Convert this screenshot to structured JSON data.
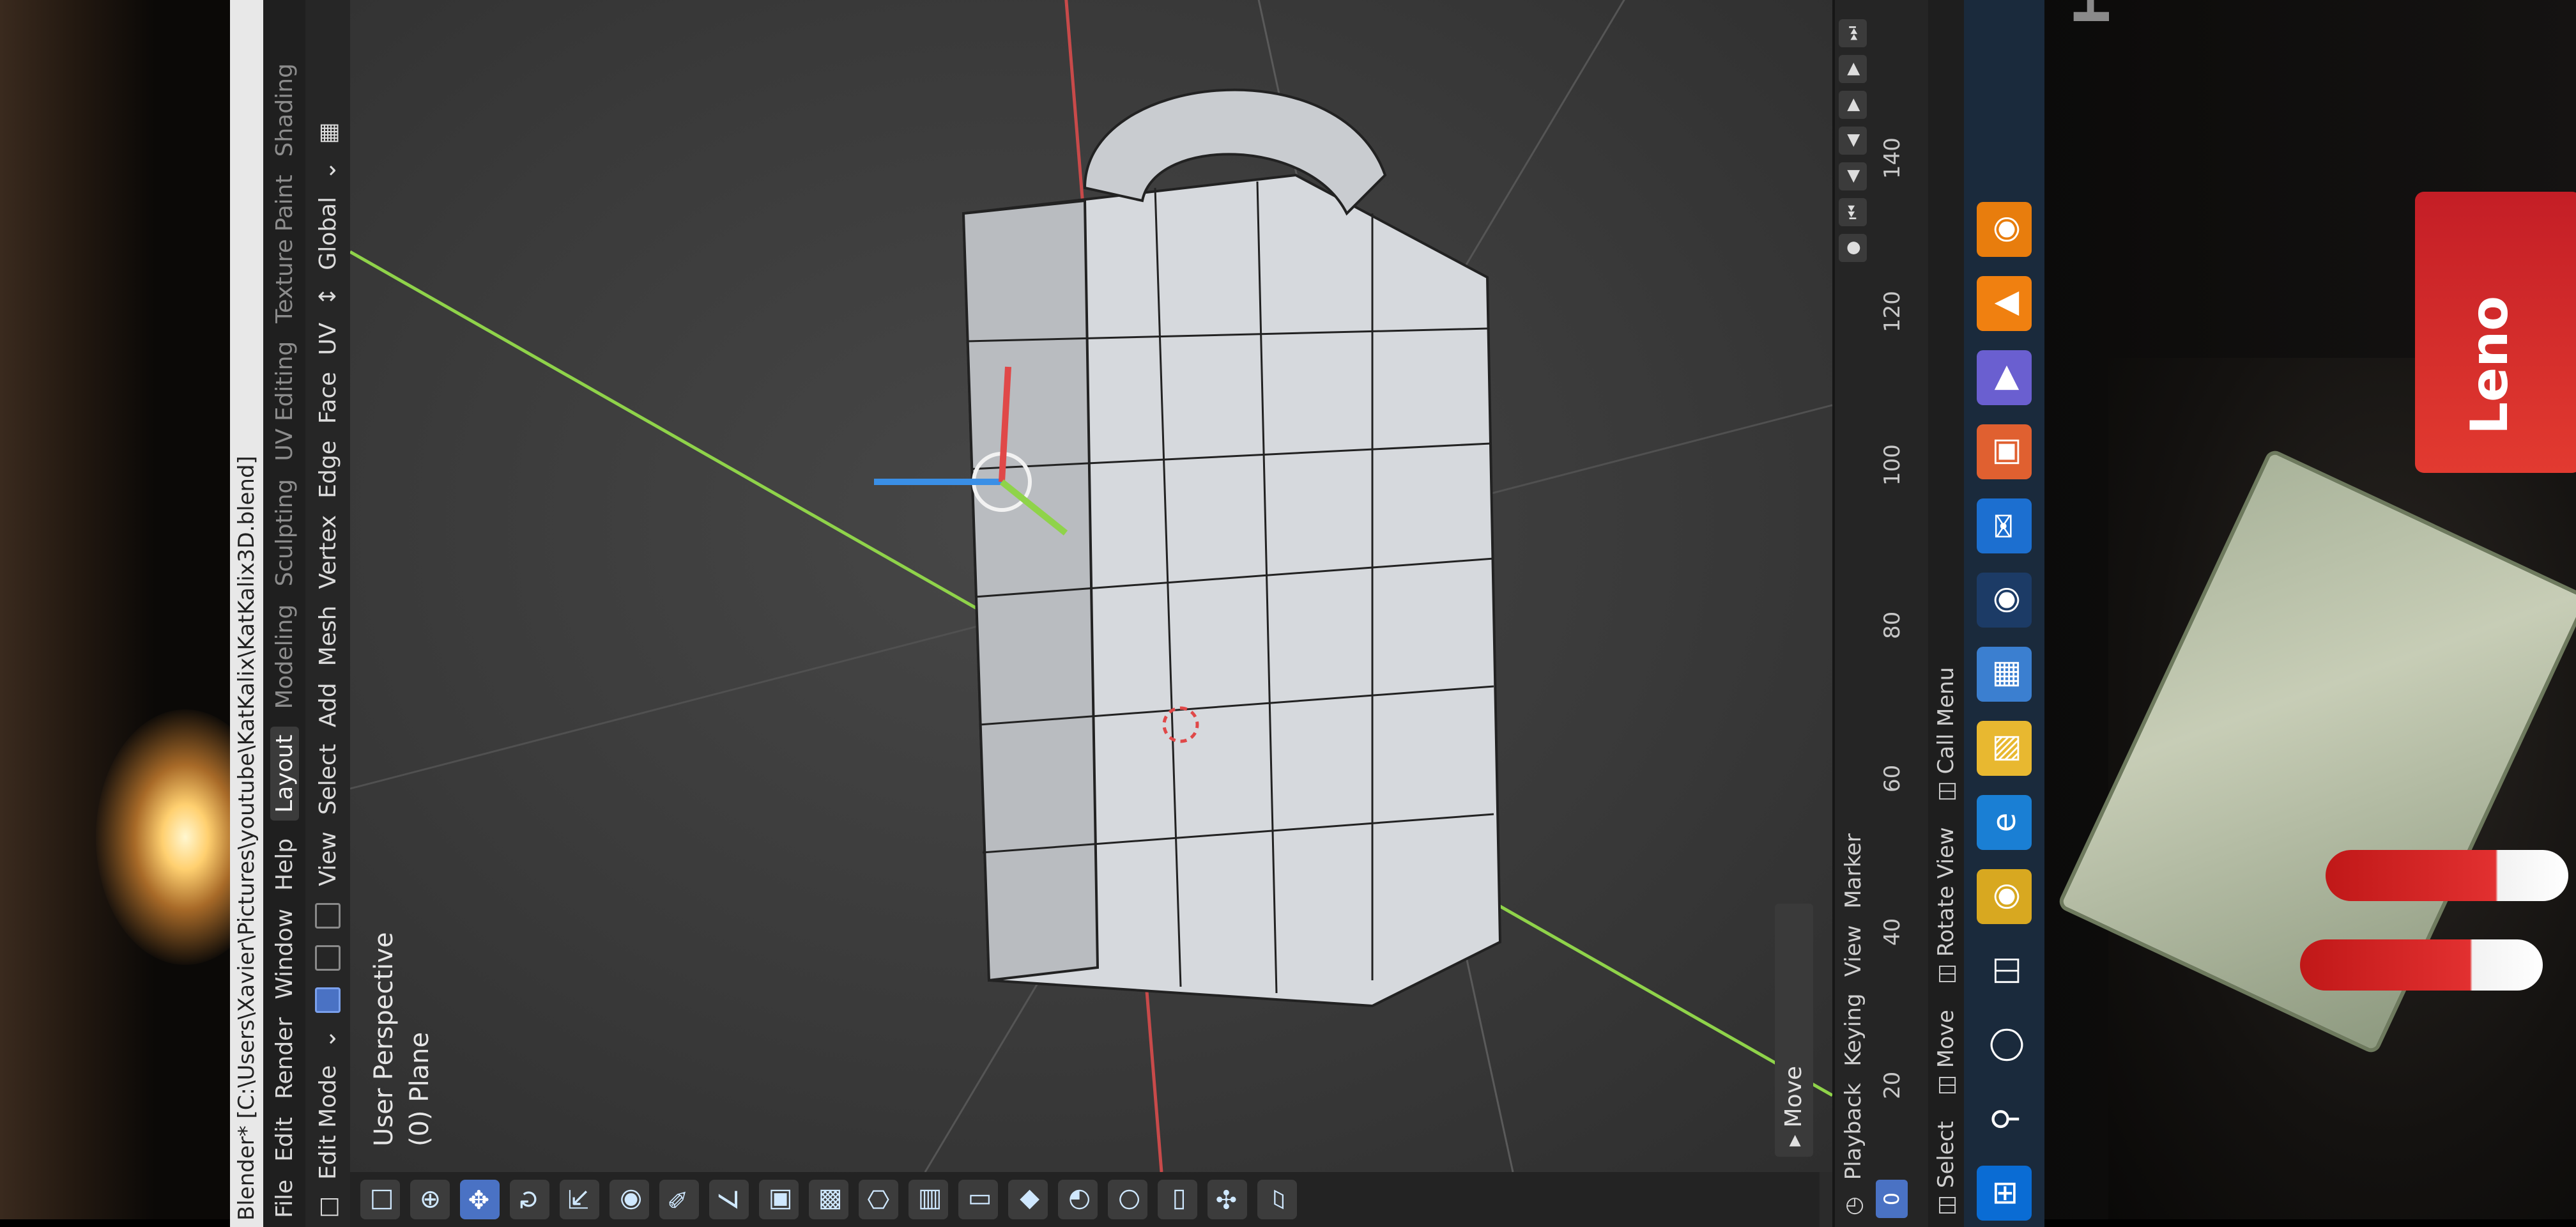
{
  "window": {
    "title": "Blender* [C:\\Users\\Xavier\\Pictures\\youtube\\KatKalix\\KatKalix3D.blend]"
  },
  "menu": [
    "File",
    "Edit",
    "Render",
    "Window",
    "Help"
  ],
  "workspaces": [
    "Layout",
    "Modeling",
    "Sculpting",
    "UV Editing",
    "Texture Paint",
    "Shading"
  ],
  "active_workspace": "Layout",
  "header": {
    "mode": "Edit Mode",
    "items": [
      "View",
      "Select",
      "Add",
      "Mesh",
      "Vertex",
      "Edge",
      "Face",
      "UV"
    ],
    "orientation": "Global"
  },
  "viewport": {
    "perspective_label": "User Perspective",
    "object_label": "(0) Plane",
    "last_op_panel": "Move"
  },
  "timeline": {
    "menus": [
      "Playback",
      "Keying",
      "View",
      "Marker"
    ],
    "current_frame": "0",
    "ticks": [
      "20",
      "40",
      "60",
      "80",
      "100",
      "120",
      "140"
    ]
  },
  "statusbar": {
    "items": [
      "Select",
      "Move",
      "Rotate View",
      "Call Menu"
    ]
  },
  "scene": {
    "monitor_brand": "HUI",
    "box_text": "Leno"
  },
  "colors": {
    "accent": "#4a72c4",
    "x_axis": "#e04848",
    "y_axis": "#8fd34a",
    "z_axis": "#3a8fe6"
  },
  "icons": {
    "taskbar": [
      "windows-start-icon",
      "search-icon",
      "cortana-icon",
      "task-view-icon",
      "chrome-icon",
      "edge-icon",
      "file-explorer-icon",
      "microsoft-store-icon",
      "steam-icon",
      "mail-icon",
      "photos-icon",
      "media-player-icon",
      "vlc-icon",
      "blender-icon"
    ]
  }
}
